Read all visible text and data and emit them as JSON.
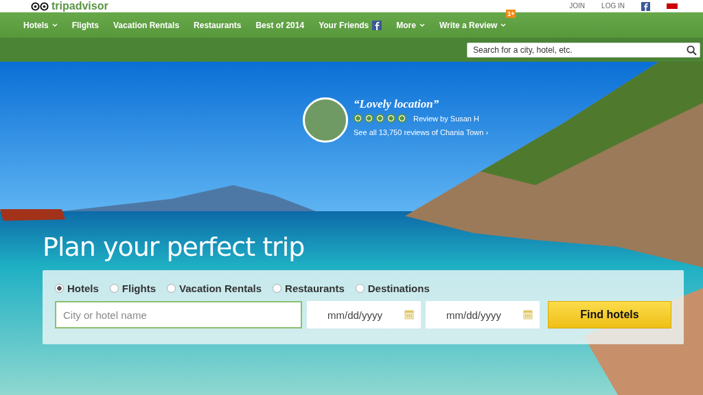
{
  "header": {
    "logo": "tripadvisor",
    "links": [
      "JOIN",
      "LOG IN"
    ]
  },
  "nav": [
    {
      "label": "Hotels",
      "kind": "dropdown"
    },
    {
      "label": "Flights",
      "kind": "plain"
    },
    {
      "label": "Vacation Rentals",
      "kind": "plain"
    },
    {
      "label": "Restaurants",
      "kind": "plain"
    },
    {
      "label": "Best of 2014",
      "kind": "plain"
    },
    {
      "label": "Your Friends",
      "kind": "facebook"
    },
    {
      "label": "More",
      "kind": "dropdown"
    },
    {
      "label": "Write a Review",
      "kind": "dropdown",
      "badge": "1+"
    }
  ],
  "search": {
    "placeholder": "Search for a city, hotel, etc."
  },
  "review": {
    "quote": "“Lovely location”",
    "stars": 5,
    "author": "Review by Susan H",
    "link": "See all 13,750 reviews of Chania Town",
    "link_arrow": "›"
  },
  "headline": "Plan your perfect trip",
  "options": [
    {
      "label": "Hotels",
      "selected": true
    },
    {
      "label": "Flights",
      "selected": false
    },
    {
      "label": "Vacation Rentals",
      "selected": false
    },
    {
      "label": "Restaurants",
      "selected": false
    },
    {
      "label": "Destinations",
      "selected": false
    }
  ],
  "where": {
    "placeholder": "City or hotel name"
  },
  "dates": [
    {
      "placeholder": "mm/dd/yyyy"
    },
    {
      "placeholder": "mm/dd/yyyy"
    }
  ],
  "submit": "Find hotels"
}
